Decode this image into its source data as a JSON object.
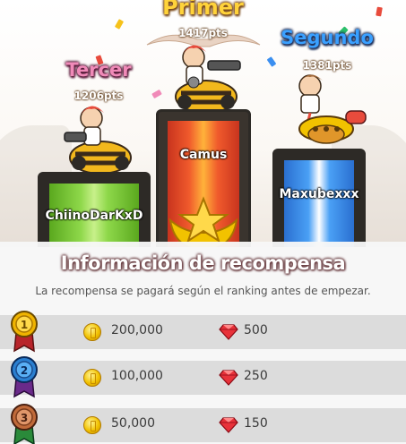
{
  "podium": {
    "first": {
      "rank_title": "Primer",
      "points": "1417pts",
      "player": "Camus"
    },
    "second": {
      "rank_title": "Segundo",
      "points": "1381pts",
      "player": "Maxubexxx"
    },
    "third": {
      "rank_title": "Tercer",
      "points": "1206pts",
      "player": "ChiinoDarKxD"
    }
  },
  "reward_panel": {
    "title": "Información de recompensa",
    "subtitle": "La recompensa se pagará según el ranking antes de empezar.",
    "rows": [
      {
        "rank": "1",
        "coins": "200,000",
        "gems": "500"
      },
      {
        "rank": "2",
        "coins": "100,000",
        "gems": "250"
      },
      {
        "rank": "3",
        "coins": "50,000",
        "gems": "150"
      }
    ]
  },
  "colors": {
    "first_title": "#ffd33a",
    "second_title": "#3aa0ff",
    "third_title": "#f08ab8",
    "first_banner": "#e8462c",
    "second_banner": "#3b8ff0",
    "third_banner": "#7ec83a",
    "medal_gold": "#f0b400",
    "medal_blue": "#2a7fd0",
    "medal_bronze": "#c06a3a"
  },
  "icons": [
    "coin-icon",
    "ruby-gem-icon",
    "medal-icon",
    "gold-star-emblem-icon"
  ]
}
